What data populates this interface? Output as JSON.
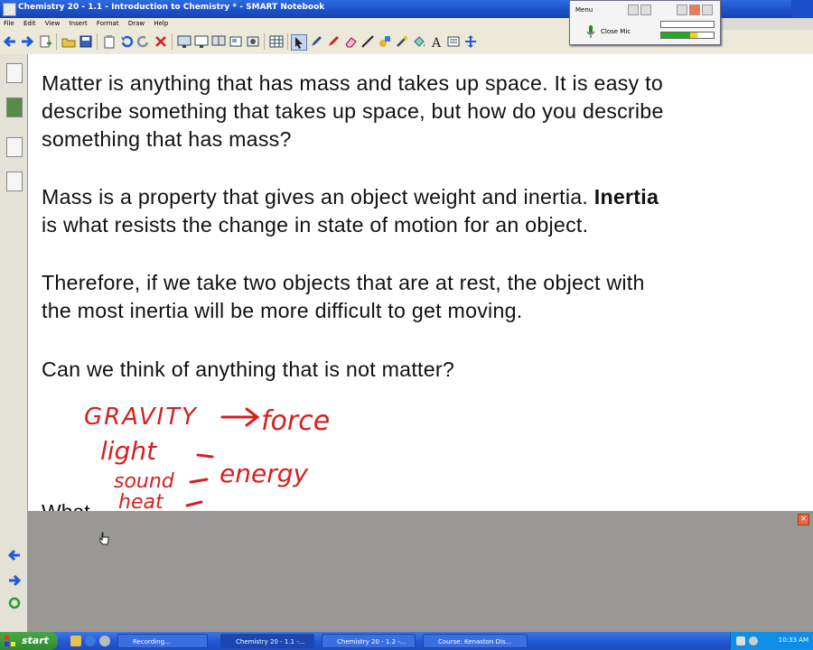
{
  "window": {
    "title": "Chemistry 20 - 1.1 - Introduction to Chemistry * - SMART Notebook"
  },
  "menu": [
    "File",
    "Edit",
    "View",
    "Insert",
    "Format",
    "Draw",
    "Help"
  ],
  "recorder": {
    "menu_label": "Menu",
    "close_mic_label": "Close Mic"
  },
  "content": {
    "p1": [
      "Matter is anything that has mass and takes up space.  It is easy to",
      "describe something that takes up space, but how do you describe",
      "something that has mass?"
    ],
    "p2_l1_pre": "Mass is a property that gives an object weight and inertia.  ",
    "p2_l1_bold": "Inertia",
    "p2_l2": "is what resists the change in state of motion for an object.",
    "p3": [
      "Therefore, if we take two objects that are at rest, the object with",
      "the most inertia will be more difficult to get moving."
    ],
    "p4": "Can we think of anything that is not matter?",
    "cut_line": "What ... ... ... ... ... ... ... ... ... ... ..."
  },
  "handwriting": {
    "gravity": "GRAVITY",
    "force": "force",
    "light": "light",
    "sound": "sound",
    "heat": "heat",
    "energy": "energy",
    "ink_color": "#d42020"
  },
  "taskbar": {
    "start_label": "start",
    "tasks": [
      "Recording...",
      "Chemistry 20 - 1.1 -...",
      "Chemistry 20 - 1.2 -...",
      "Course: Kenaston Dis..."
    ],
    "clock": "10:33 AM"
  }
}
